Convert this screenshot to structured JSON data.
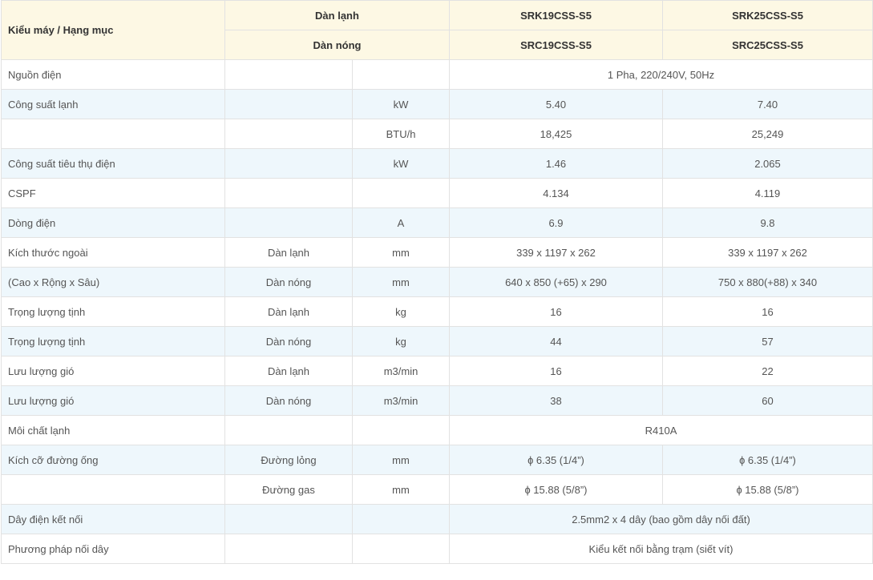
{
  "header": {
    "model_label": "Kiểu máy / Hạng mục",
    "indoor_label": "Dàn lạnh",
    "outdoor_label": "Dàn nóng",
    "indoor_models": [
      "SRK19CSS-S5",
      "SRK25CSS-S5"
    ],
    "outdoor_models": [
      "SRC19CSS-S5",
      "SRC25CSS-S5"
    ]
  },
  "rows": [
    {
      "label": "Nguồn điện",
      "sub": "",
      "unit": "",
      "merged": "1 Pha, 220/240V, 50Hz"
    },
    {
      "label": "Công suất lạnh",
      "sub": "",
      "unit": "kW",
      "v1": "5.40",
      "v2": "7.40"
    },
    {
      "label": "",
      "sub": "",
      "unit": "BTU/h",
      "v1": "18,425",
      "v2": "25,249"
    },
    {
      "label": "Công suất tiêu thụ điện",
      "sub": "",
      "unit": "kW",
      "v1": "1.46",
      "v2": "2.065"
    },
    {
      "label": "CSPF",
      "sub": "",
      "unit": "",
      "v1": "4.134",
      "v2": "4.119"
    },
    {
      "label": "Dòng điện",
      "sub": "",
      "unit": "A",
      "v1": "6.9",
      "v2": "9.8"
    },
    {
      "label": "Kích thước ngoài",
      "sub": "Dàn lạnh",
      "unit": "mm",
      "v1": "339 x 1197 x 262",
      "v2": "339 x 1197 x 262"
    },
    {
      "label": "(Cao x Rộng x Sâu)",
      "sub": "Dàn nóng",
      "unit": "mm",
      "v1": "640 x 850 (+65) x 290",
      "v2": "750 x 880(+88) x 340"
    },
    {
      "label": "Trọng lượng tịnh",
      "sub": "Dàn lạnh",
      "unit": "kg",
      "v1": "16",
      "v2": "16"
    },
    {
      "label": "Trọng lượng tịnh",
      "sub": "Dàn nóng",
      "unit": "kg",
      "v1": "44",
      "v2": "57"
    },
    {
      "label": "Lưu lượng gió",
      "sub": "Dàn lạnh",
      "unit": "m3/min",
      "v1": "16",
      "v2": "22"
    },
    {
      "label": "Lưu lượng gió",
      "sub": "Dàn nóng",
      "unit": "m3/min",
      "v1": "38",
      "v2": "60"
    },
    {
      "label": "Môi chất lạnh",
      "sub": "",
      "unit": "",
      "merged": "R410A"
    },
    {
      "label": "Kích cỡ đường ống",
      "sub": "Đường lỏng",
      "unit": "mm",
      "v1": "ɸ 6.35 (1/4”)",
      "v2": "ɸ 6.35 (1/4”)"
    },
    {
      "label": "",
      "sub": "Đường gas",
      "unit": "mm",
      "v1": "ɸ 15.88 (5/8”)",
      "v2": "ɸ 15.88 (5/8”)"
    },
    {
      "label": "Dây điện kết nối",
      "sub": "",
      "unit": "",
      "merged": "2.5mm2 x 4 dây (bao gồm dây nối đất)"
    },
    {
      "label": "Phương pháp nối dây",
      "sub": "",
      "unit": "",
      "merged": "Kiểu kết nối bằng trạm (siết vít)"
    }
  ]
}
